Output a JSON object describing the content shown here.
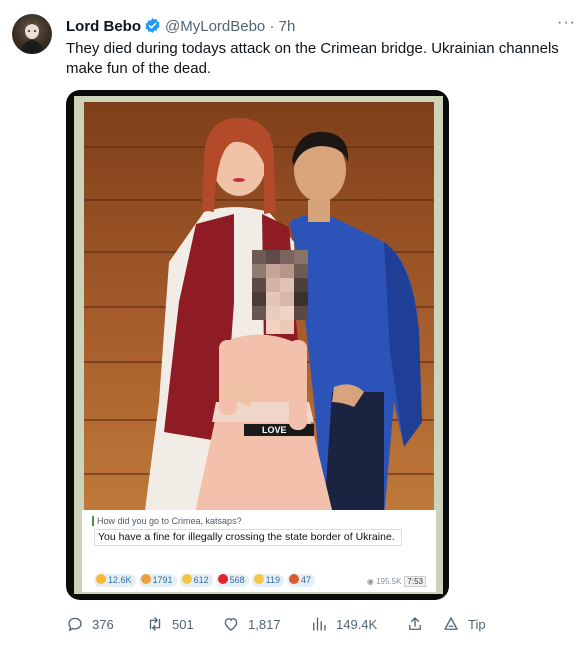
{
  "tweet": {
    "author_name": "Lord Bebo",
    "handle": "@MyLordBebo",
    "separator": "·",
    "time": "7h",
    "more": "···",
    "text": "They died during todays attack on the Crimean bridge. Ukrainian channels make fun of the dead."
  },
  "media": {
    "reply_quote": "How did you go to Crimea, katsaps?",
    "message": "You have a fine for illegally crossing the state border of Ukraine.",
    "reactions": [
      {
        "icon": "thumbs-up-icon",
        "count": "12.6K"
      },
      {
        "icon": "party-popper-icon",
        "count": "1791"
      },
      {
        "icon": "laughing-face-icon",
        "count": "612"
      },
      {
        "icon": "heart-icon",
        "count": "568"
      },
      {
        "icon": "crying-face-icon",
        "count": "119"
      },
      {
        "icon": "angry-face-icon",
        "count": "47"
      }
    ],
    "views": "195.5K",
    "post_time": "7:53",
    "shirt_text": "LOVE"
  },
  "actions": {
    "replies": "376",
    "retweets": "501",
    "likes": "1,817",
    "views": "149.4K",
    "tip": "Tip"
  },
  "colors": {
    "verified": "#1d9bf0",
    "text_secondary": "#536471",
    "reaction_text": "#2c6eaa"
  }
}
